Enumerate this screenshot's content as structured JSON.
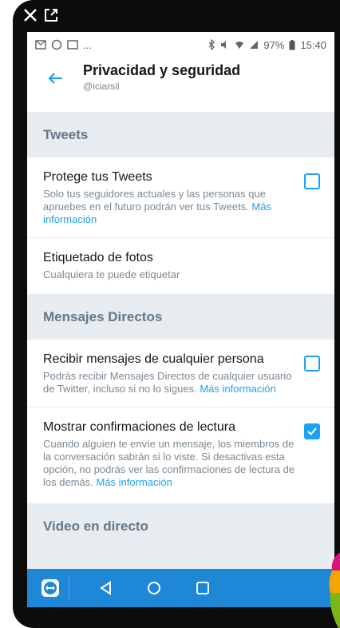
{
  "status_bar": {
    "battery": "97%",
    "time": "15:40",
    "ellipsis": "..."
  },
  "app_bar": {
    "title": "Privacidad y seguridad",
    "subtitle": "@iciarsil"
  },
  "sections": {
    "tweets": {
      "header": "Tweets",
      "protect": {
        "title": "Protege tus Tweets",
        "desc": "Solo tus seguidores actuales y las personas que apruebes en el futuro podrán ver tus Tweets. ",
        "link": "Más información",
        "checked": false
      },
      "photo_tag": {
        "title": "Etiquetado de fotos",
        "desc": "Cualquiera te puede etiquetar"
      }
    },
    "dm": {
      "header": "Mensajes Directos",
      "receive": {
        "title": "Recibir mensajes de cualquier persona",
        "desc": "Podrás recibir Mensajes Directos de cualquier usuario de Twitter, incluso si no lo sigues. ",
        "link": "Más información",
        "checked": false
      },
      "read_receipts": {
        "title": "Mostrar confirmaciones de lectura",
        "desc": "Cuando alguien te envíe un mensaje, los miembros de la conversación sabrán si lo viste. Si desactivas esta opción, no podrás ver las confirmaciones de lectura de los demás. ",
        "link": "Más información",
        "checked": true
      }
    },
    "video": {
      "header": "Video en directo"
    }
  },
  "colors": {
    "accent": "#1da1f2",
    "nav_bar": "#1e88d6",
    "section_bg": "#e6ecf0"
  },
  "icons": [
    "close-icon",
    "external-window-icon",
    "back-arrow-icon",
    "nav-back-icon",
    "nav-home-icon",
    "nav-recents-icon",
    "teamviewer-icon"
  ]
}
